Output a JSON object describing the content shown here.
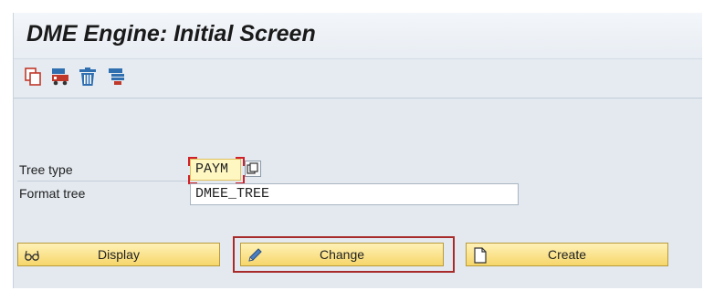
{
  "window": {
    "title": "DME Engine: Initial Screen"
  },
  "toolbar": {
    "icons": [
      "copy-icon",
      "transport-icon",
      "delete-icon",
      "where-used-icon"
    ]
  },
  "form": {
    "tree_type": {
      "label": "Tree type",
      "value": "PAYM"
    },
    "format_tree": {
      "label": "Format tree",
      "value": "DMEE_TREE"
    }
  },
  "buttons": {
    "display": {
      "label": "Display",
      "icon": "glasses-icon"
    },
    "change": {
      "label": "Change",
      "icon": "pencil-icon"
    },
    "create": {
      "label": "Create",
      "icon": "blank-page-icon"
    }
  },
  "colors": {
    "button_bg": "#f6d66a",
    "highlight_border": "#a82b2b",
    "required_field_bg": "#fff7c2"
  }
}
